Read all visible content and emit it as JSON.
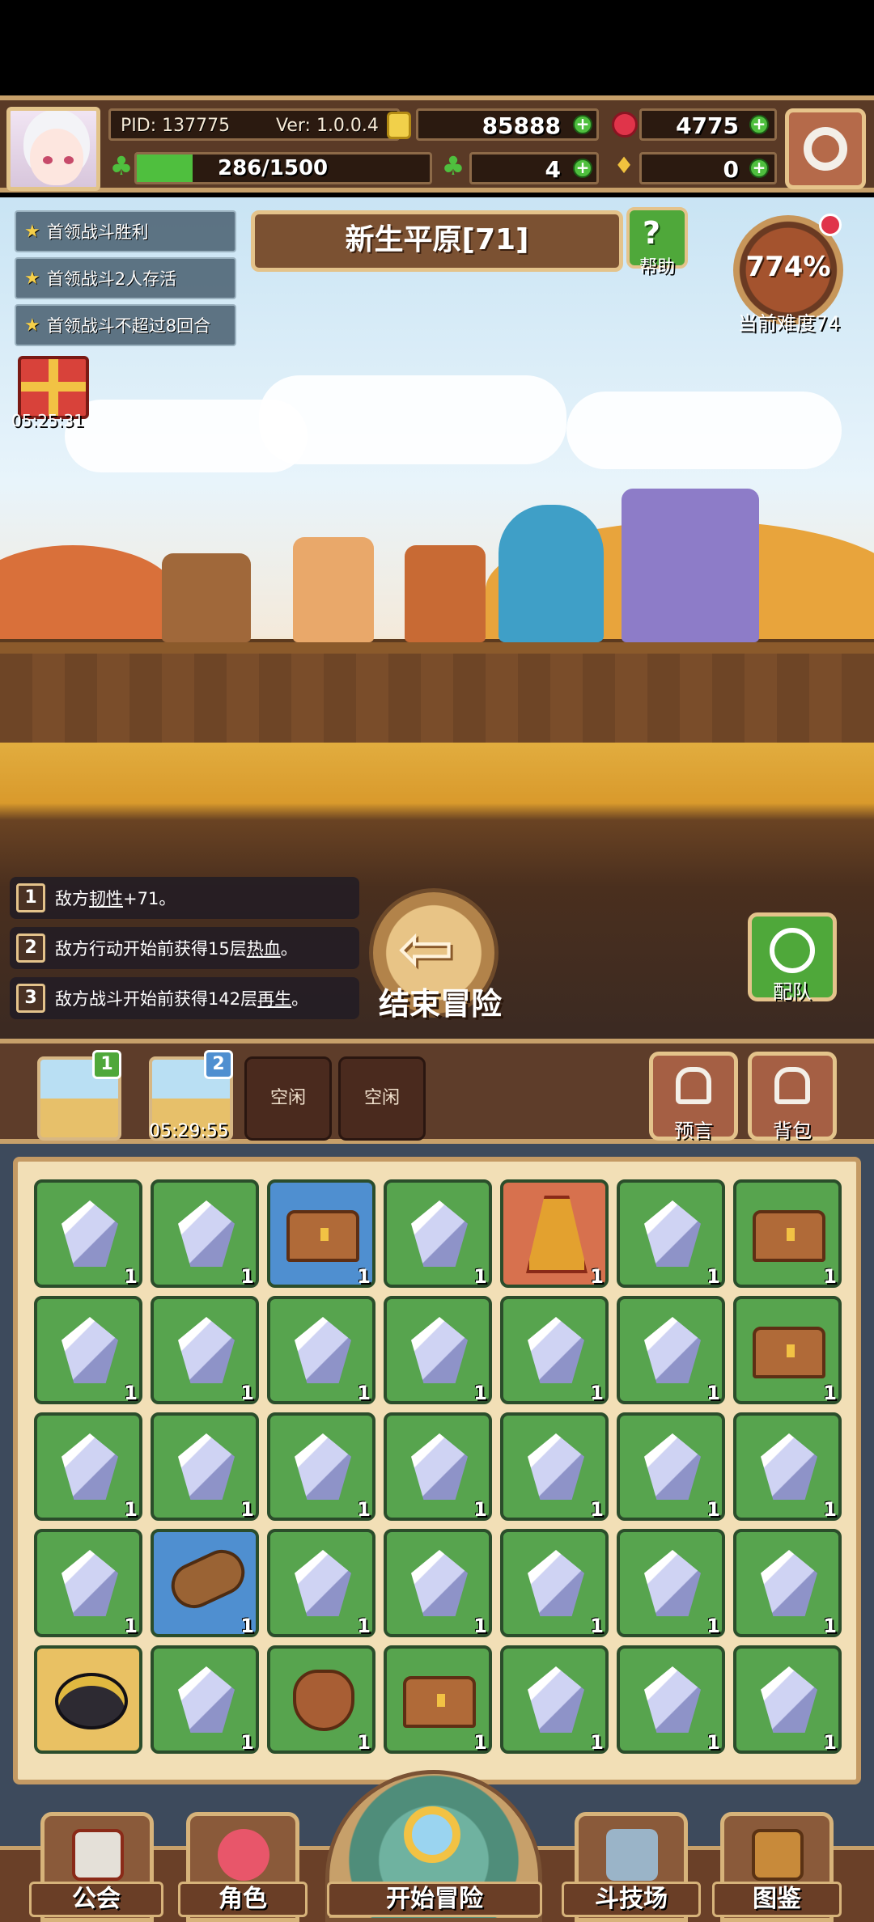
{
  "hud": {
    "pid": "PID: 137775",
    "version": "Ver: 1.0.0.4",
    "gold": "85888",
    "gems": "4775",
    "stamina": "286/1500",
    "stamina_fraction": 0.19,
    "clover": "4",
    "keys": "0"
  },
  "quests": [
    {
      "label": "首领战斗胜利"
    },
    {
      "label": "首领战斗2人存活"
    },
    {
      "label": "首领战斗不超过8回合"
    }
  ],
  "stage": {
    "title": "新生平原[71]",
    "help_label": "帮助",
    "difficulty_pct": "774%",
    "difficulty_label": "当前难度74"
  },
  "gift": {
    "timer": "05:25:31"
  },
  "buffs": [
    {
      "num": "1",
      "text_a": "敌方",
      "keyword": "韧性",
      "text_b": "+71。"
    },
    {
      "num": "2",
      "text_a": "敌方行动开始前获得15层",
      "keyword": "热血",
      "text_b": "。"
    },
    {
      "num": "3",
      "text_a": "敌方战斗开始前获得142层",
      "keyword": "再生",
      "text_b": "。"
    }
  ],
  "actions": {
    "end_adventure": "结束冒险",
    "team": "配队"
  },
  "slots": {
    "slot1_badge": "1",
    "slot2_badge": "2",
    "slot2_timer": "05:29:55",
    "empty_a": "空闲",
    "empty_b": "空闲",
    "prophecy": "预言",
    "backpack": "背包"
  },
  "inventory": [
    [
      {
        "type": "gem",
        "bg": "green",
        "count": "1"
      },
      {
        "type": "gem",
        "bg": "green",
        "count": "1"
      },
      {
        "type": "chest",
        "bg": "blue",
        "count": "1"
      },
      {
        "type": "gem",
        "bg": "green",
        "count": "1"
      },
      {
        "type": "cape",
        "bg": "red",
        "count": "1"
      },
      {
        "type": "gem",
        "bg": "green",
        "count": "1"
      },
      {
        "type": "chest",
        "bg": "green",
        "count": "1"
      }
    ],
    [
      {
        "type": "gem",
        "bg": "green",
        "count": "1"
      },
      {
        "type": "gem",
        "bg": "green",
        "count": "1"
      },
      {
        "type": "gem",
        "bg": "green",
        "count": "1"
      },
      {
        "type": "gem",
        "bg": "green",
        "count": "1"
      },
      {
        "type": "gem",
        "bg": "green",
        "count": "1"
      },
      {
        "type": "gem",
        "bg": "green",
        "count": "1"
      },
      {
        "type": "chest",
        "bg": "green",
        "count": "1"
      }
    ],
    [
      {
        "type": "gem",
        "bg": "green",
        "count": "1"
      },
      {
        "type": "gem",
        "bg": "green",
        "count": "1"
      },
      {
        "type": "gem",
        "bg": "green",
        "count": "1"
      },
      {
        "type": "gem",
        "bg": "green",
        "count": "1"
      },
      {
        "type": "gem",
        "bg": "green",
        "count": "1"
      },
      {
        "type": "gem",
        "bg": "green",
        "count": "1"
      },
      {
        "type": "gem",
        "bg": "green",
        "count": "1"
      }
    ],
    [
      {
        "type": "gem",
        "bg": "green",
        "count": "1"
      },
      {
        "type": "log",
        "bg": "blue",
        "count": "1"
      },
      {
        "type": "gem",
        "bg": "green",
        "count": "1"
      },
      {
        "type": "gem",
        "bg": "green",
        "count": "1"
      },
      {
        "type": "gem",
        "bg": "green",
        "count": "1"
      },
      {
        "type": "gem",
        "bg": "green",
        "count": "1"
      },
      {
        "type": "gem",
        "bg": "green",
        "count": "1"
      }
    ],
    [
      {
        "type": "pot",
        "bg": "gold",
        "count": ""
      },
      {
        "type": "gem",
        "bg": "green",
        "count": "1"
      },
      {
        "type": "bag",
        "bg": "green",
        "count": "1"
      },
      {
        "type": "chest",
        "bg": "green",
        "count": "1"
      },
      {
        "type": "gem",
        "bg": "green",
        "count": "1"
      },
      {
        "type": "gem",
        "bg": "green",
        "count": "1"
      },
      {
        "type": "gem",
        "bg": "green",
        "count": "1"
      }
    ]
  ],
  "nav": {
    "guild": "公会",
    "character": "角色",
    "start_adventure": "开始冒险",
    "arena": "斗技场",
    "codex": "图鉴"
  }
}
